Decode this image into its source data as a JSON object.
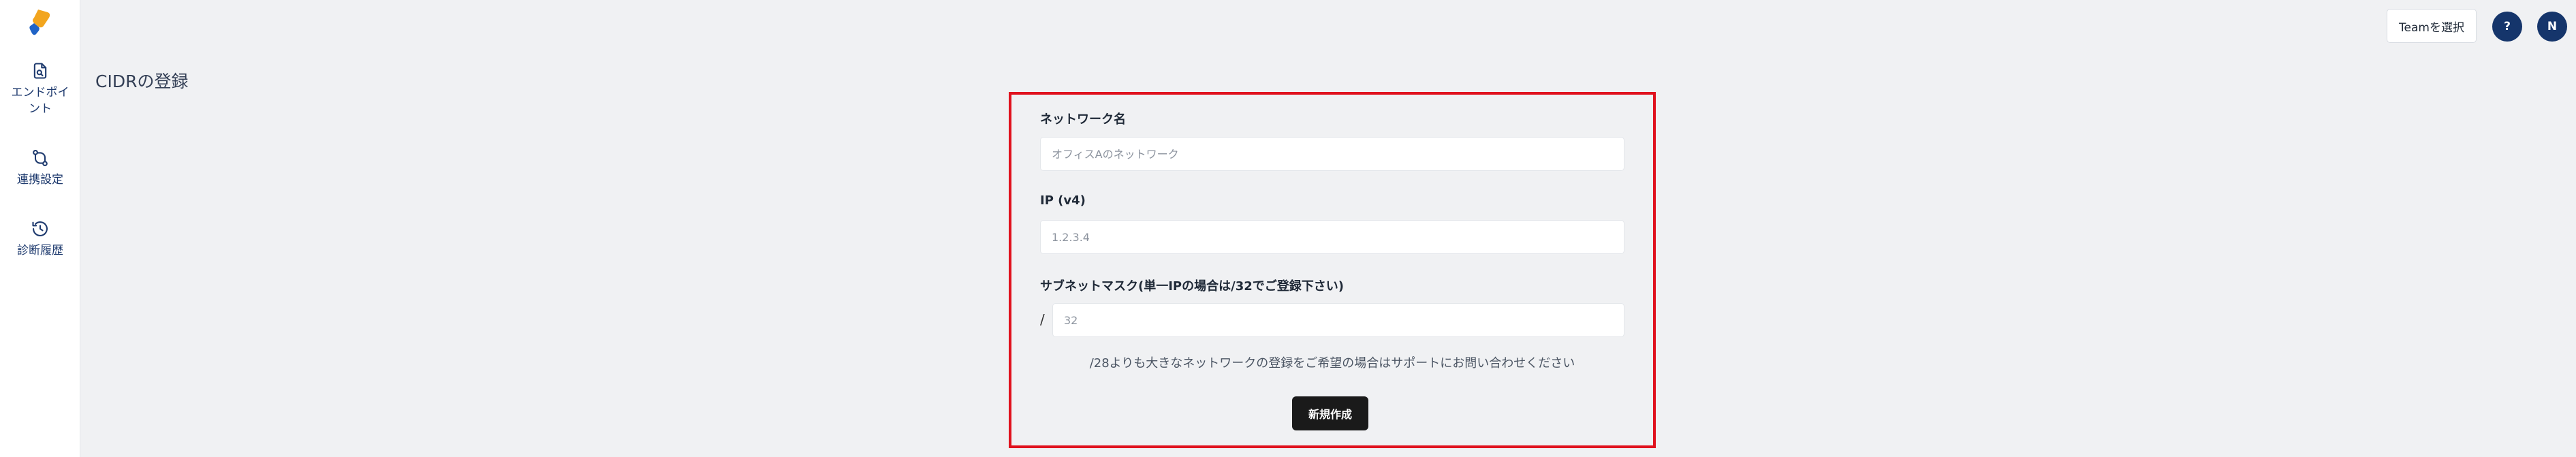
{
  "sidebar": {
    "items": [
      {
        "label": "エンドポイント",
        "icon": "document-search-icon"
      },
      {
        "label": "連携設定",
        "icon": "git-pull-request-icon"
      },
      {
        "label": "診断履歴",
        "icon": "history-icon"
      }
    ]
  },
  "header": {
    "team_select_label": "Teamを選択",
    "help_label": "?",
    "avatar_initial": "N"
  },
  "page": {
    "title": "CIDRの登録"
  },
  "form": {
    "network_name": {
      "label": "ネットワーク名",
      "placeholder": "オフィスAのネットワーク",
      "value": ""
    },
    "ip": {
      "label": "IP (v4)",
      "placeholder": "1.2.3.4",
      "value": ""
    },
    "subnet": {
      "label": "サブネットマスク(単一IPの場合は/32でご登録下さい)",
      "prefix": "/",
      "placeholder": "32",
      "value": ""
    },
    "note": "/28よりも大きなネットワークの登録をご希望の場合はサポートにお問い合わせください",
    "submit_label": "新規作成"
  },
  "colors": {
    "accent_navy": "#15356b",
    "highlight_border": "#e0121e",
    "button_dark": "#1a1a1a"
  }
}
